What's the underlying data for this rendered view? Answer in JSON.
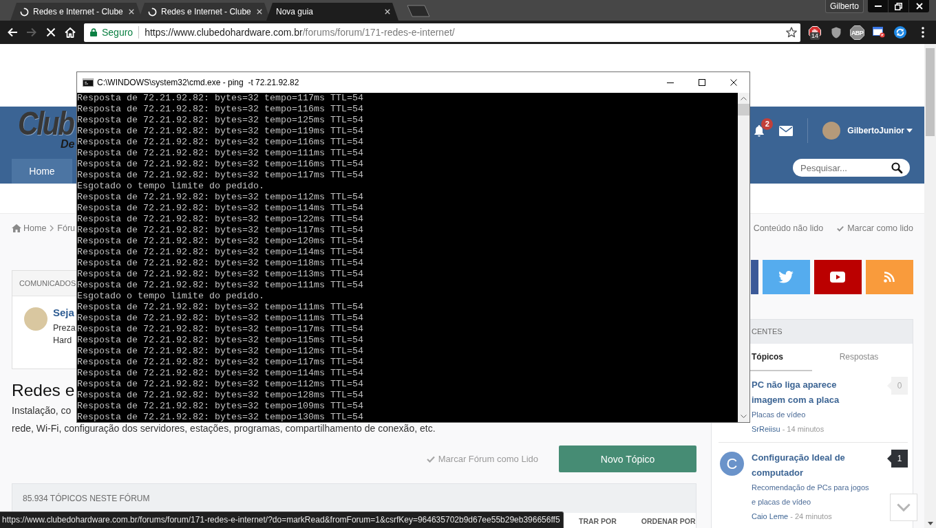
{
  "browser": {
    "tabs": [
      {
        "title": "Redes e Internet - Clube",
        "loading": true,
        "selected": false
      },
      {
        "title": "Redes e Internet - Clube",
        "loading": true,
        "selected": false
      },
      {
        "title": "Nova guia",
        "loading": false,
        "selected": true
      }
    ],
    "profile": "Gilberto",
    "toolbar": {
      "forward_disabled": true,
      "security": "Seguro",
      "url_host": "https://www.clubedohardware.com.br",
      "url_path": "/forums/forum/171-redes-e-internet/"
    },
    "extensions": [
      {
        "kind": "stop",
        "badge": "14"
      },
      {
        "kind": "shield"
      },
      {
        "kind": "octagon",
        "label": "ABP"
      },
      {
        "kind": "window"
      },
      {
        "kind": "sync"
      }
    ]
  },
  "site": {
    "logo": {
      "title": "Club",
      "subtitle": "De"
    },
    "header": {
      "notification_count": "2",
      "user_name": "GilbertoJunior"
    },
    "nav": [
      {
        "label": "Home",
        "selected": true
      }
    ],
    "search": {
      "placeholder": "Pesquisar..."
    },
    "breadcrumb": [
      "Home",
      "Fóru"
    ],
    "page_links": [
      {
        "kind": "unread",
        "label": "Conteúdo não lido"
      },
      {
        "kind": "mark_read",
        "label": "Marcar como lido"
      }
    ],
    "announcements": {
      "title": "COMUNICADOS",
      "heading": "Seja",
      "lines": [
        "Preza",
        "Hard"
      ]
    },
    "forum": {
      "title": "Redes e",
      "description": [
        "Instalação, co",
        "rede, Wi-Fi, configuração dos servidores, estações, programas, compartilhamento de conexão, etc."
      ],
      "mark_read": "Marcar Fórum como Lido",
      "new_topic": "Novo Tópico"
    },
    "topics": {
      "count": "85.934 TÓPICOS NESTE FÓRUM",
      "filters": [
        "TRAR POR",
        "ORDENAR POR"
      ]
    },
    "social": [
      {
        "kind": "facebook",
        "color": "#3b5998"
      },
      {
        "kind": "twitter",
        "color": "#55acee"
      },
      {
        "kind": "youtube",
        "color": "#bb0000"
      },
      {
        "kind": "rss",
        "color": "#f99b3c"
      }
    ],
    "recent": {
      "title": "CENTES",
      "tabs": [
        {
          "label": "Tópicos",
          "selected": true
        },
        {
          "label": "Respostas",
          "selected": false
        }
      ],
      "items": [
        {
          "title": "PC não liga aparece imagem com a placa",
          "replies": "0",
          "highlighted": false,
          "forum": "Placas de vídeo",
          "author": "SrReiisu",
          "time": "- 14 minutos"
        },
        {
          "avatar": {
            "letter": "C",
            "color": "#6a93ca"
          },
          "title": "Configuração Ideal de computador",
          "replies": "1",
          "highlighted": true,
          "forum": "Recomendação de PCs para jogos e placas de vídeo",
          "author": "Caio Leme",
          "time": "- 24 minutos"
        }
      ]
    }
  },
  "console": {
    "title": "C:\\WINDOWS\\system32\\cmd.exe - ping  -t 72.21.92.82",
    "lines": [
      "Resposta de 72.21.92.82: bytes=32 tempo=117ms TTL=54",
      "Resposta de 72.21.92.82: bytes=32 tempo=116ms TTL=54",
      "Resposta de 72.21.92.82: bytes=32 tempo=125ms TTL=54",
      "Resposta de 72.21.92.82: bytes=32 tempo=119ms TTL=54",
      "Resposta de 72.21.92.82: bytes=32 tempo=116ms TTL=54",
      "Resposta de 72.21.92.82: bytes=32 tempo=111ms TTL=54",
      "Resposta de 72.21.92.82: bytes=32 tempo=116ms TTL=54",
      "Resposta de 72.21.92.82: bytes=32 tempo=117ms TTL=54",
      "Esgotado o tempo limite do pedido.",
      "Resposta de 72.21.92.82: bytes=32 tempo=112ms TTL=54",
      "Resposta de 72.21.92.82: bytes=32 tempo=114ms TTL=54",
      "Resposta de 72.21.92.82: bytes=32 tempo=122ms TTL=54",
      "Resposta de 72.21.92.82: bytes=32 tempo=117ms TTL=54",
      "Resposta de 72.21.92.82: bytes=32 tempo=120ms TTL=54",
      "Resposta de 72.21.92.82: bytes=32 tempo=114ms TTL=54",
      "Resposta de 72.21.92.82: bytes=32 tempo=118ms TTL=54",
      "Resposta de 72.21.92.82: bytes=32 tempo=113ms TTL=54",
      "Resposta de 72.21.92.82: bytes=32 tempo=111ms TTL=54",
      "Esgotado o tempo limite do pedido.",
      "Resposta de 72.21.92.82: bytes=32 tempo=111ms TTL=54",
      "Resposta de 72.21.92.82: bytes=32 tempo=111ms TTL=54",
      "Resposta de 72.21.92.82: bytes=32 tempo=117ms TTL=54",
      "Resposta de 72.21.92.82: bytes=32 tempo=115ms TTL=54",
      "Resposta de 72.21.92.82: bytes=32 tempo=112ms TTL=54",
      "Resposta de 72.21.92.82: bytes=32 tempo=117ms TTL=54",
      "Resposta de 72.21.92.82: bytes=32 tempo=114ms TTL=54",
      "Resposta de 72.21.92.82: bytes=32 tempo=112ms TTL=54",
      "Resposta de 72.21.92.82: bytes=32 tempo=128ms TTL=54",
      "Resposta de 72.21.92.82: bytes=32 tempo=109ms TTL=54",
      "Resposta de 72.21.92.82: bytes=32 tempo=130ms TTL=54"
    ]
  },
  "status_url": "https://www.clubedohardware.com.br/forums/forum/171-redes-e-internet/?do=markRead&fromForum=1&csrfKey=964635702b9d67ee55b29eb396656ff5"
}
